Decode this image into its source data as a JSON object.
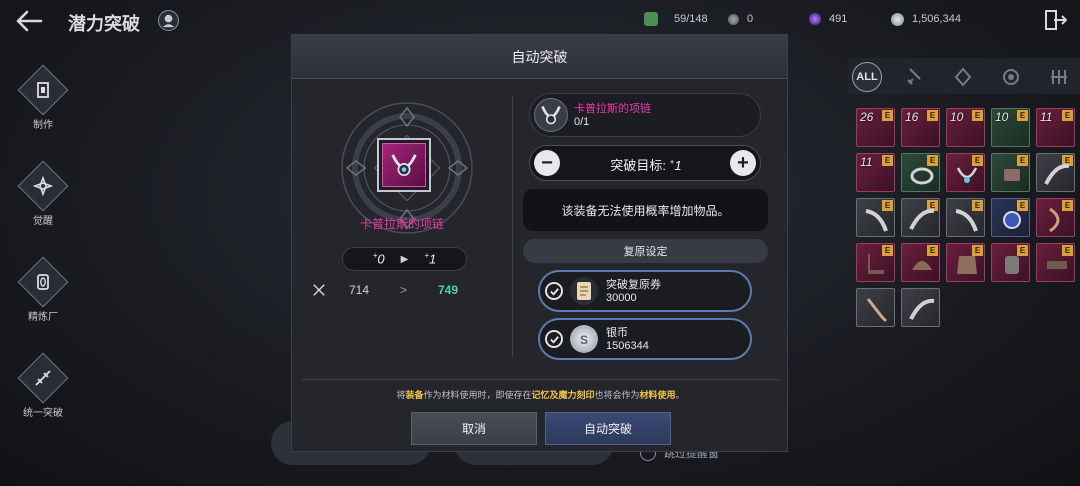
{
  "header": {
    "title": "潜力突破",
    "currencies": [
      {
        "icon": "green-gem-icon",
        "value": "59/148",
        "color": "#4b8f53"
      },
      {
        "icon": "gray-ore-icon",
        "value": "0",
        "color": "#8a8a8a"
      },
      {
        "icon": "purple-orb-icon",
        "value": "491",
        "color": "#7b3cd8"
      },
      {
        "icon": "silver-coin-icon",
        "value": "1,506,344",
        "color": "#b7bcc6"
      }
    ]
  },
  "sidenav": {
    "items": [
      {
        "label": "制作",
        "icon": "craft-icon"
      },
      {
        "label": "觉醒",
        "icon": "awaken-icon"
      },
      {
        "label": "精炼厂",
        "icon": "refinery-icon"
      },
      {
        "label": "统一突破",
        "icon": "unify-break-icon"
      }
    ]
  },
  "filters": {
    "all_label": "ALL"
  },
  "inventory": {
    "slots": [
      {
        "rarity": "pink",
        "level": "26",
        "badge": "E"
      },
      {
        "rarity": "pink",
        "level": "16",
        "badge": "E"
      },
      {
        "rarity": "pink",
        "level": "10",
        "badge": "E"
      },
      {
        "rarity": "green",
        "level": "10",
        "badge": "E"
      },
      {
        "rarity": "pink",
        "level": "11",
        "badge": "E"
      },
      {
        "rarity": "pink",
        "level": "11",
        "badge": "E"
      },
      {
        "rarity": "green",
        "level": "",
        "badge": "E"
      },
      {
        "rarity": "pink",
        "level": "",
        "badge": "E"
      },
      {
        "rarity": "green",
        "level": "",
        "badge": "E"
      },
      {
        "rarity": "gray",
        "level": "",
        "badge": "E"
      },
      {
        "rarity": "gray",
        "level": "",
        "badge": "E"
      },
      {
        "rarity": "gray",
        "level": "",
        "badge": "E"
      },
      {
        "rarity": "gray",
        "level": "",
        "badge": "E"
      },
      {
        "rarity": "blue",
        "level": "",
        "badge": "E"
      },
      {
        "rarity": "pink",
        "level": "",
        "badge": "E"
      },
      {
        "rarity": "pink",
        "level": "",
        "badge": "E"
      },
      {
        "rarity": "pink",
        "level": "",
        "badge": "E"
      },
      {
        "rarity": "pink",
        "level": "",
        "badge": "E"
      },
      {
        "rarity": "pink",
        "level": "",
        "badge": "E"
      },
      {
        "rarity": "pink",
        "level": "",
        "badge": "E"
      },
      {
        "rarity": "gray",
        "level": "",
        "badge": ""
      },
      {
        "rarity": "gray",
        "level": "",
        "badge": ""
      }
    ]
  },
  "background": {
    "skip_label": "跳过提醒窗"
  },
  "modal": {
    "title": "自动突破",
    "item_name": "卡普拉斯的项链",
    "level_from": "0",
    "level_to": "1",
    "stat_from": "714",
    "stat_arrow": ">",
    "stat_to": "749",
    "material": {
      "name": "卡普拉斯的项链",
      "count": "0/1"
    },
    "target_label": "突破目标: ",
    "target_value": "1",
    "notice": "该装备无法使用概率增加物品。",
    "restore_title": "复原设定",
    "restore_options": [
      {
        "name": "突破复原券",
        "amount": "30000",
        "icon": "scroll-icon"
      },
      {
        "name": "银币",
        "amount": "1506344",
        "icon": "silver-coin-icon"
      }
    ],
    "warning": {
      "p1": "将",
      "equip": "装备",
      "p2": "作为材料使用时，即使存在",
      "memory": "记忆及魔力刻印",
      "p3": "也将会作为",
      "material": "材料使用",
      "p4": "。"
    },
    "cancel_label": "取消",
    "confirm_label": "自动突破"
  }
}
